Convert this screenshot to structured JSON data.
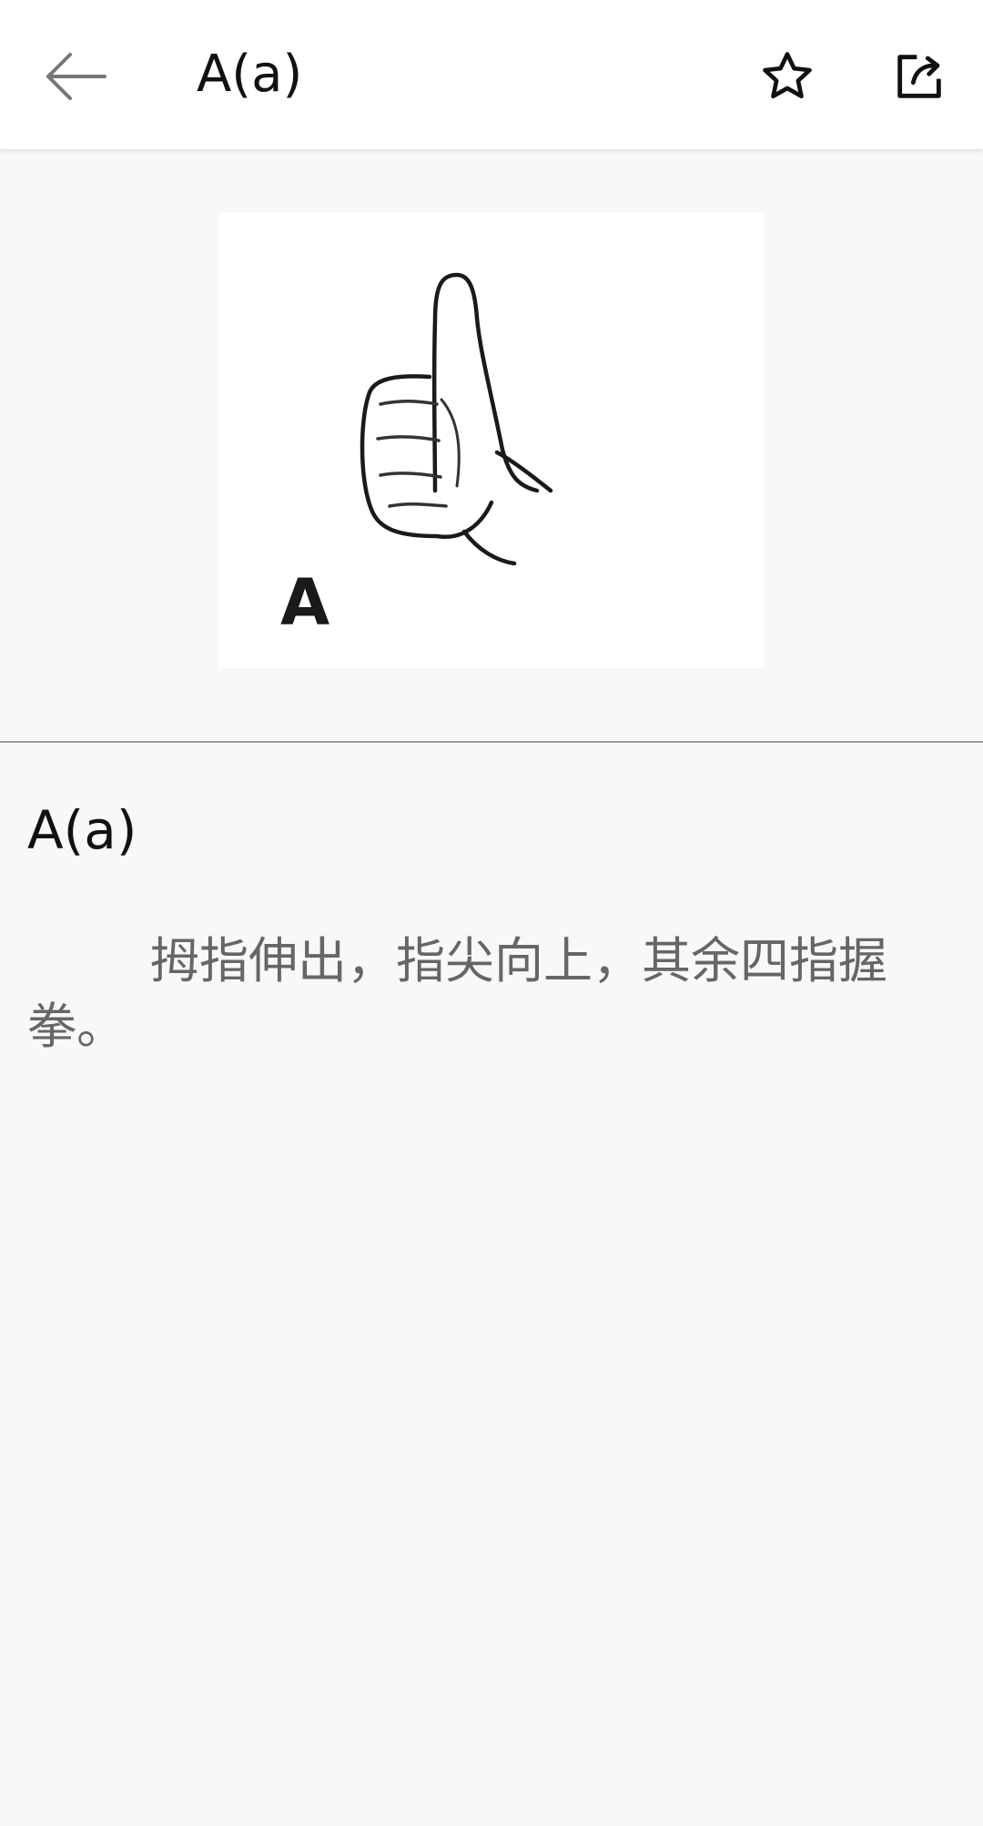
{
  "header": {
    "title": "A(a)",
    "icons": [
      "back-arrow-icon",
      "star-icon",
      "share-icon"
    ]
  },
  "image": {
    "letter_label": "A"
  },
  "content": {
    "title": "A(a)",
    "description": "拇指伸出，指尖向上，其余四指握拳。"
  }
}
